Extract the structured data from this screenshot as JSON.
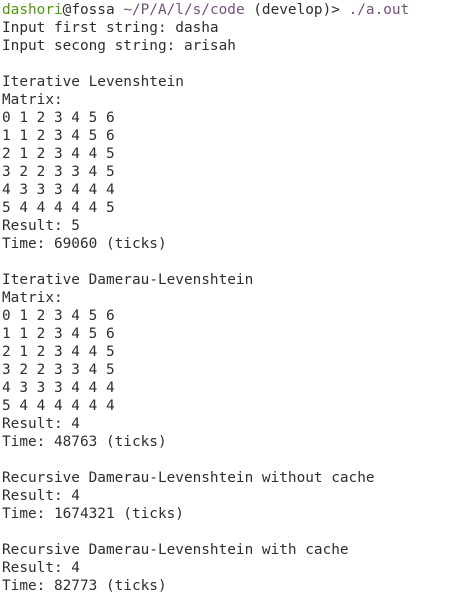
{
  "prompt": {
    "user": "dashori",
    "host": "@fossa",
    "path": "~/P/A/l/s/code",
    "branch": " (develop)> ",
    "command": "./a.out"
  },
  "output_lines": [
    "Input first string: dasha",
    "Input secong string: arisah",
    "",
    "Iterative Levenshtein",
    "Matrix:",
    "0 1 2 3 4 5 6",
    "1 1 2 3 4 5 6",
    "2 1 2 3 4 4 5",
    "3 2 2 3 3 4 5",
    "4 3 3 3 4 4 4",
    "5 4 4 4 4 4 5",
    "Result: 5",
    "Time: 69060 (ticks)",
    "",
    "Iterative Damerau-Levenshtein",
    "Matrix:",
    "0 1 2 3 4 5 6",
    "1 1 2 3 4 5 6",
    "2 1 2 3 4 4 5",
    "3 2 2 3 3 4 5",
    "4 3 3 3 4 4 4",
    "5 4 4 4 4 4 4",
    "Result: 4",
    "Time: 48763 (ticks)",
    "",
    "Recursive Damerau-Levenshtein without cache",
    "Result: 4",
    "Time: 1674321 (ticks)",
    "",
    "Recursive Damerau-Levenshtein with cache",
    "Result: 4",
    "Time: 82773 (ticks)"
  ],
  "colors": {
    "background": "#ffffff",
    "text": "#2e2e2e",
    "user": "#4e9a06",
    "path": "#75507b",
    "command": "#75507b"
  }
}
